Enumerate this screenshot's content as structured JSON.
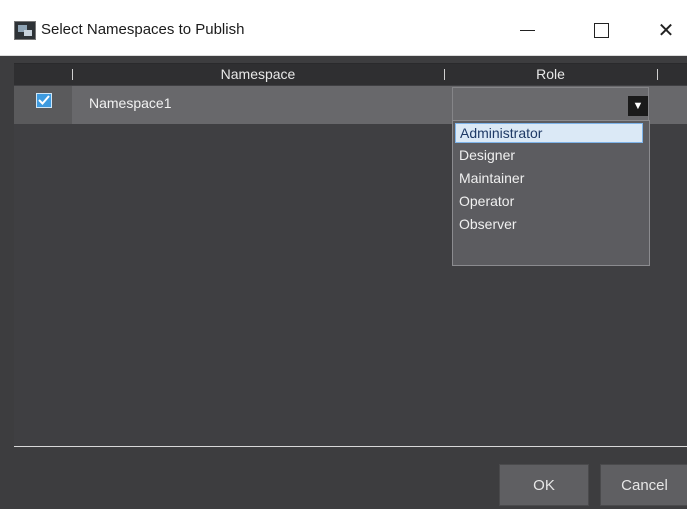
{
  "window": {
    "title": "Select Namespaces to Publish",
    "minimize_icon": "minimize-icon",
    "maximize_icon": "maximize-icon",
    "close_icon": "close-icon",
    "close_glyph": "✕"
  },
  "table": {
    "columns": [
      "Namespace",
      "Role"
    ],
    "rows": [
      {
        "checked": true,
        "namespace": "Namespace1",
        "role": ""
      }
    ]
  },
  "role_dropdown": {
    "options": [
      "Administrator",
      "Designer",
      "Maintainer",
      "Operator",
      "Observer"
    ],
    "highlighted": "Administrator",
    "arrow_glyph": "▼"
  },
  "buttons": {
    "ok": "OK",
    "cancel": "Cancel"
  },
  "colors": {
    "background": "#3d3d3f",
    "row": "#68686b",
    "accent": "#3e9be0",
    "highlight": "#dbe9f6"
  }
}
